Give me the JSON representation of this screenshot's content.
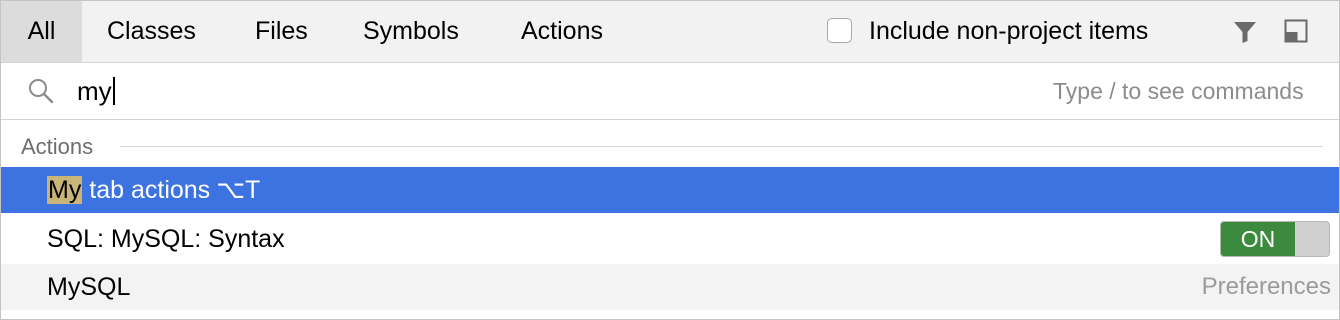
{
  "tabs": {
    "all": "All",
    "classes": "Classes",
    "files": "Files",
    "symbols": "Symbols",
    "actions": "Actions"
  },
  "options": {
    "include_non_project_label": "Include non-project items",
    "include_non_project_checked": false
  },
  "toolbar_icons": [
    "filter-icon",
    "window-icon"
  ],
  "search": {
    "icon": "search-icon",
    "query": "my",
    "hint": "Type / to see commands"
  },
  "results": {
    "section_label": "Actions",
    "items": [
      {
        "match": "My",
        "rest": " tab actions",
        "shortcut": "⌥T",
        "selected": true
      },
      {
        "text": "SQL: MySQL: Syntax",
        "toggle": "ON"
      },
      {
        "text": "MySQL",
        "hint": "Preferences"
      }
    ]
  },
  "colors": {
    "selection": "#3d73e0",
    "match_highlight": "#c8b577",
    "toggle_on": "#3c8a3e"
  }
}
